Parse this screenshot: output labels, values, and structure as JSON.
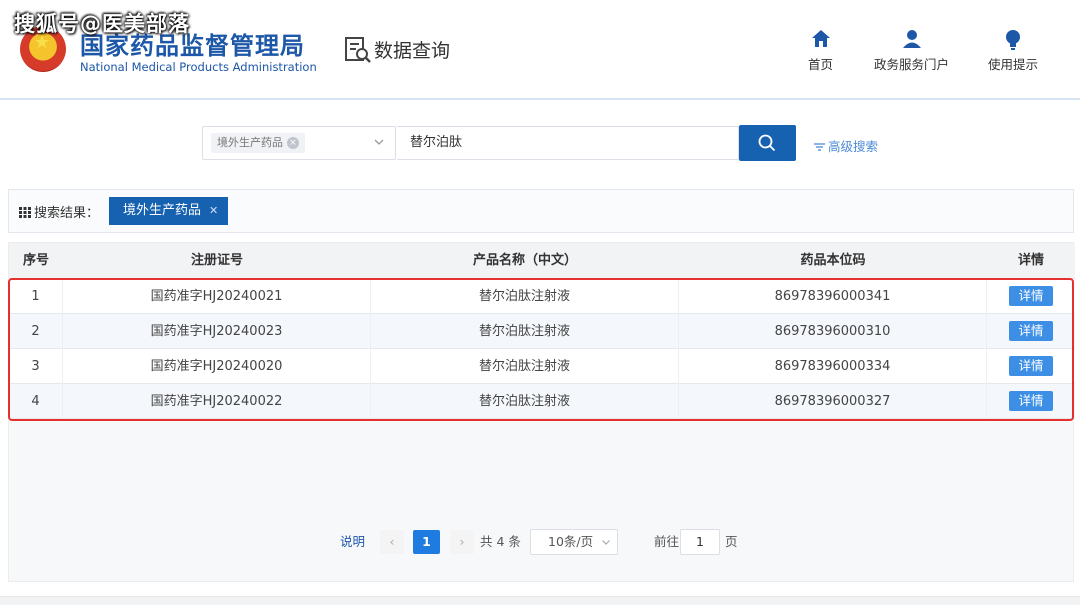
{
  "watermark": "搜狐号@医美部落",
  "header": {
    "agency_cn": "国家药品监督管理局",
    "agency_en": "National Medical Products Administration",
    "section_title": "数据查询",
    "nav": [
      {
        "label": "首页",
        "icon": "home-icon"
      },
      {
        "label": "政务服务门户",
        "icon": "user-icon"
      },
      {
        "label": "使用提示",
        "icon": "lightbulb-icon"
      }
    ]
  },
  "search": {
    "category_tag": "境外生产药品",
    "query": "替尔泊肽",
    "advanced_label": "高级搜索"
  },
  "results": {
    "label": "搜索结果：",
    "filter_tag": "境外生产药品"
  },
  "table": {
    "headers": [
      "序号",
      "注册证号",
      "产品名称（中文）",
      "药品本位码",
      "详情"
    ],
    "rows": [
      {
        "index": "1",
        "reg_no": "国药准字HJ20240021",
        "name": "替尔泊肽注射液",
        "code": "86978396000341",
        "detail": "详情"
      },
      {
        "index": "2",
        "reg_no": "国药准字HJ20240023",
        "name": "替尔泊肽注射液",
        "code": "86978396000310",
        "detail": "详情"
      },
      {
        "index": "3",
        "reg_no": "国药准字HJ20240020",
        "name": "替尔泊肽注射液",
        "code": "86978396000334",
        "detail": "详情"
      },
      {
        "index": "4",
        "reg_no": "国药准字HJ20240022",
        "name": "替尔泊肽注射液",
        "code": "86978396000327",
        "detail": "详情"
      }
    ]
  },
  "pagination": {
    "help": "说明",
    "prev": "‹",
    "current": "1",
    "next": "›",
    "total": "共 4 条",
    "page_size": "10条/页",
    "goto_label": "前往",
    "goto_value": "1",
    "page_suffix": "页"
  },
  "colors": {
    "brand_blue": "#1661b0",
    "accent_blue": "#3d8fe6",
    "highlight_red": "#e5312e"
  }
}
